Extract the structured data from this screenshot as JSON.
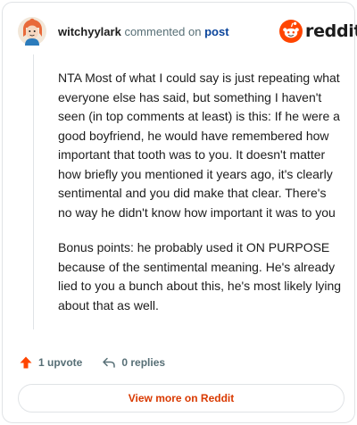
{
  "header": {
    "username": "witchyylark",
    "commented_on": "commented on",
    "post_link": "post",
    "brand": "reddit"
  },
  "comment": {
    "paragraphs": [
      "NTA Most of what I could say is just repeating what everyone else has said, but something I haven't seen (in top comments at least) is this: If he were a good boyfriend, he would have remembered how important that tooth was to you. It doesn't matter how briefly you mentioned it years ago, it's clearly sentimental and you did make that clear. There's no way he didn't know how important it was to you",
      "Bonus points: he probably used it ON PURPOSE because of the sentimental meaning. He's already lied to you a bunch about this, he's most likely lying about that as well."
    ]
  },
  "actions": {
    "upvotes": "1 upvote",
    "replies": "0 replies"
  },
  "footer": {
    "view_more": "View more on Reddit"
  },
  "colors": {
    "accent": "#d93900",
    "upvote": "#ff4500",
    "link": "#0a449b",
    "muted": "#576f76"
  },
  "icons": {
    "avatar": "avatar-icon",
    "brand": "reddit-snoo-icon",
    "upvote": "upvote-arrow-icon",
    "reply": "reply-arrow-icon"
  }
}
